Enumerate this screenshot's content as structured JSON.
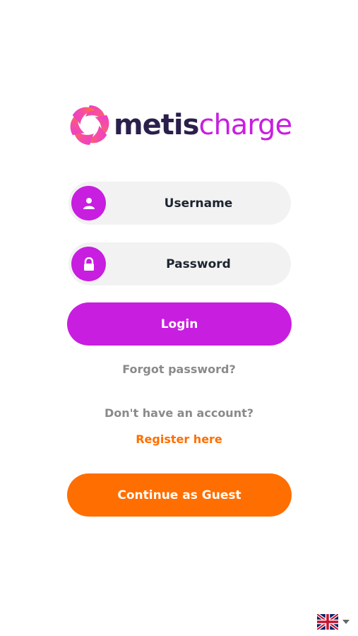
{
  "brand": {
    "name_part1": "metis",
    "name_part2": "charge",
    "colors": {
      "dark": "#2b1f4c",
      "purple": "#c81ee0",
      "orange": "#ff6e00",
      "field_bg": "#f2f2f2"
    }
  },
  "form": {
    "username_placeholder": "Username",
    "password_placeholder": "Password",
    "username_icon": "user-icon",
    "password_icon": "lock-icon",
    "login_label": "Login",
    "forgot_password": "Forgot password?",
    "no_account": "Don't have an account?",
    "register_link": "Register here",
    "guest_label": "Continue as Guest"
  },
  "language": {
    "flag": "uk-flag-icon",
    "selector_icon": "caret-down-icon"
  }
}
